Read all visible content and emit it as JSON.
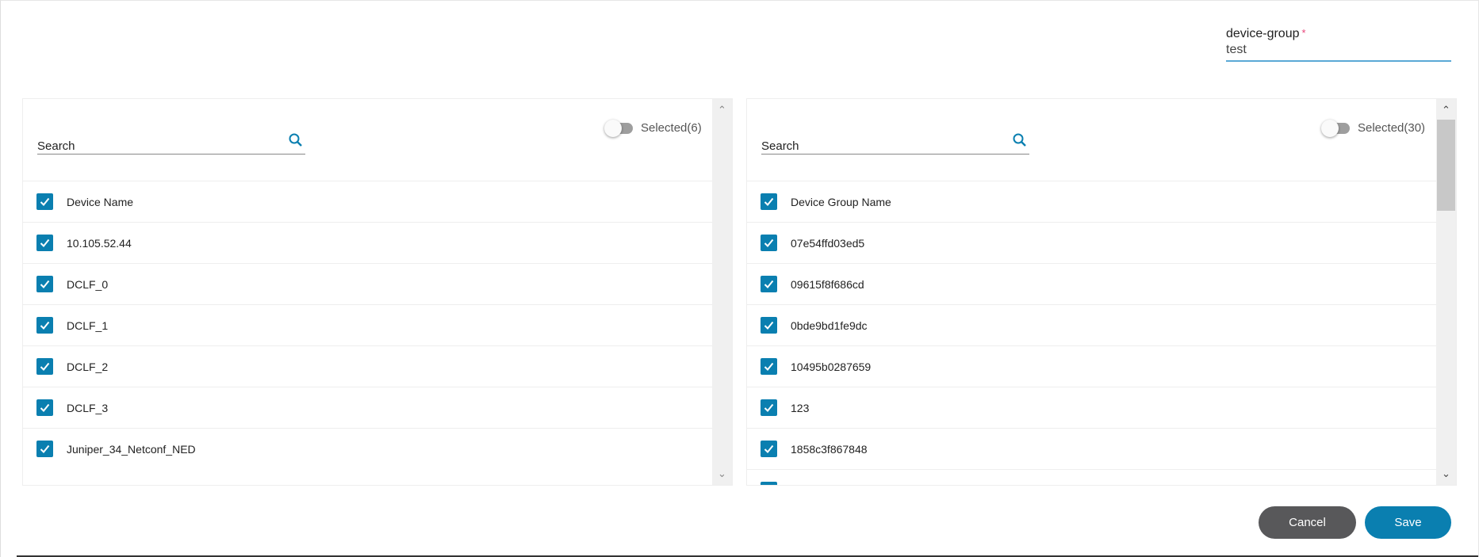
{
  "form": {
    "label": "device-group",
    "required_mark": "*",
    "value": "test"
  },
  "left_panel": {
    "search_placeholder": "Search",
    "toggle_label": "Selected(6)",
    "toggle_on": false,
    "header": "Device Name",
    "items": [
      "10.105.52.44",
      "DCLF_0",
      "DCLF_1",
      "DCLF_2",
      "DCLF_3",
      "Juniper_34_Netconf_NED"
    ]
  },
  "right_panel": {
    "search_placeholder": "Search",
    "toggle_label": "Selected(30)",
    "toggle_on": false,
    "header": "Device Group Name",
    "items": [
      "07e54ffd03ed5",
      "09615f8f686cd",
      "0bde9bd1fe9dc",
      "10495b0287659",
      "123",
      "1858c3f867848"
    ]
  },
  "actions": {
    "cancel": "Cancel",
    "save": "Save"
  },
  "colors": {
    "accent": "#0a7fb0",
    "cancel": "#58585a"
  }
}
